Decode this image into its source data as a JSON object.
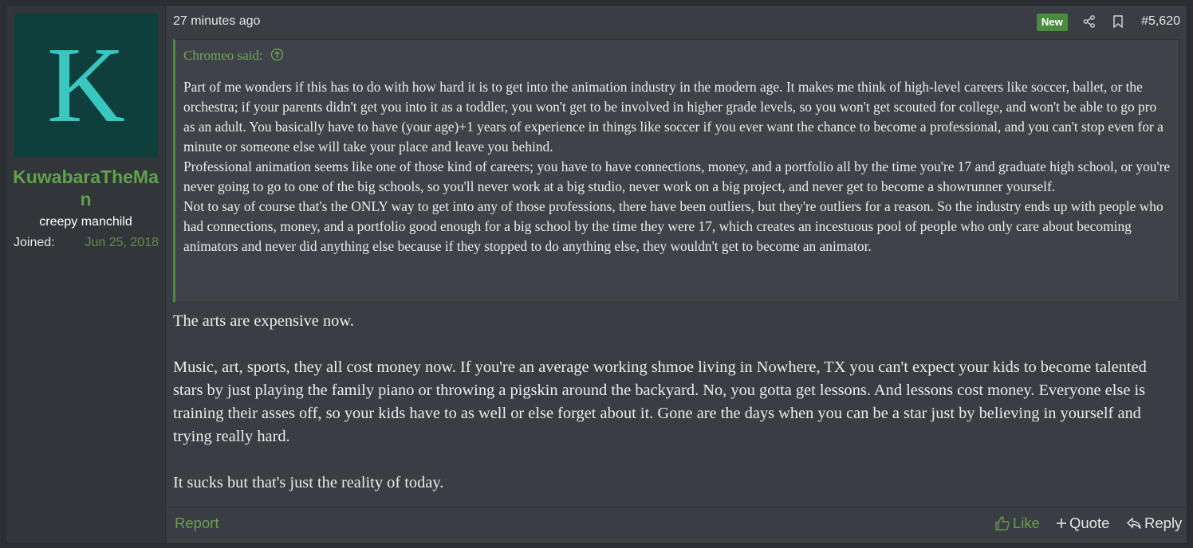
{
  "author": {
    "avatar_letter": "K",
    "username": "KuwabaraTheMan",
    "title": "creepy manchild",
    "joined_label": "Joined:",
    "joined_date": "Jun 25, 2018"
  },
  "header": {
    "time": "27 minutes ago",
    "badge": "New",
    "post_number": "#5,620",
    "icons": [
      "share-icon",
      "bookmark-icon"
    ]
  },
  "quote": {
    "author_line": "Chromeo said:",
    "paragraphs": [
      "Part of me wonders if this has to do with how hard it is to get into the animation industry in the modern age. It makes me think of high-level careers like soccer, ballet, or the orchestra; if your parents didn't get you into it as a toddler, you won't get to be involved in higher grade levels, so you won't get scouted for college, and won't be able to go pro as an adult. You basically have to have (your age)+1 years of experience in things like soccer if you ever want the chance to become a professional, and you can't stop even for a minute or someone else will take your place and leave you behind.",
      "Professional animation seems like one of those kind of careers; you have to have connections, money, and a portfolio all by the time you're 17 and graduate high school, or you're never going to go to one of the big schools, so you'll never work at a big studio, never work on a big project, and never get to become a showrunner yourself.",
      "Not to say of course that's the ONLY way to get into any of those professions, there have been outliers, but they're outliers for a reason. So the industry ends up with people who had connections, money, and a portfolio good enough for a big school by the time they were 17, which creates an incestuous pool of people who only care about becoming animators and never did anything else because if they stopped to do anything else, they wouldn't get to become an animator."
    ]
  },
  "message": {
    "paragraphs": [
      "The arts are expensive now.",
      "Music, art, sports, they all cost money now. If you're an average working shmoe living in Nowhere, TX you can't expect your kids to become talented stars by just playing the family piano or throwing a pigskin around the backyard. No, you gotta get lessons. And lessons cost money. Everyone else is training their asses off, so your kids have to as well or else forget about it. Gone are the days when you can be a star just by believing in yourself and trying really hard.",
      "It sucks but that's just the reality of today."
    ]
  },
  "footer": {
    "report": "Report",
    "like": "Like",
    "quote": "Quote",
    "reply": "Reply"
  },
  "colors": {
    "accent_green": "#5fa24a",
    "avatar_bg": "#0e3f3c",
    "avatar_fg": "#38c8c0",
    "badge_bg": "#4a8c3e"
  }
}
